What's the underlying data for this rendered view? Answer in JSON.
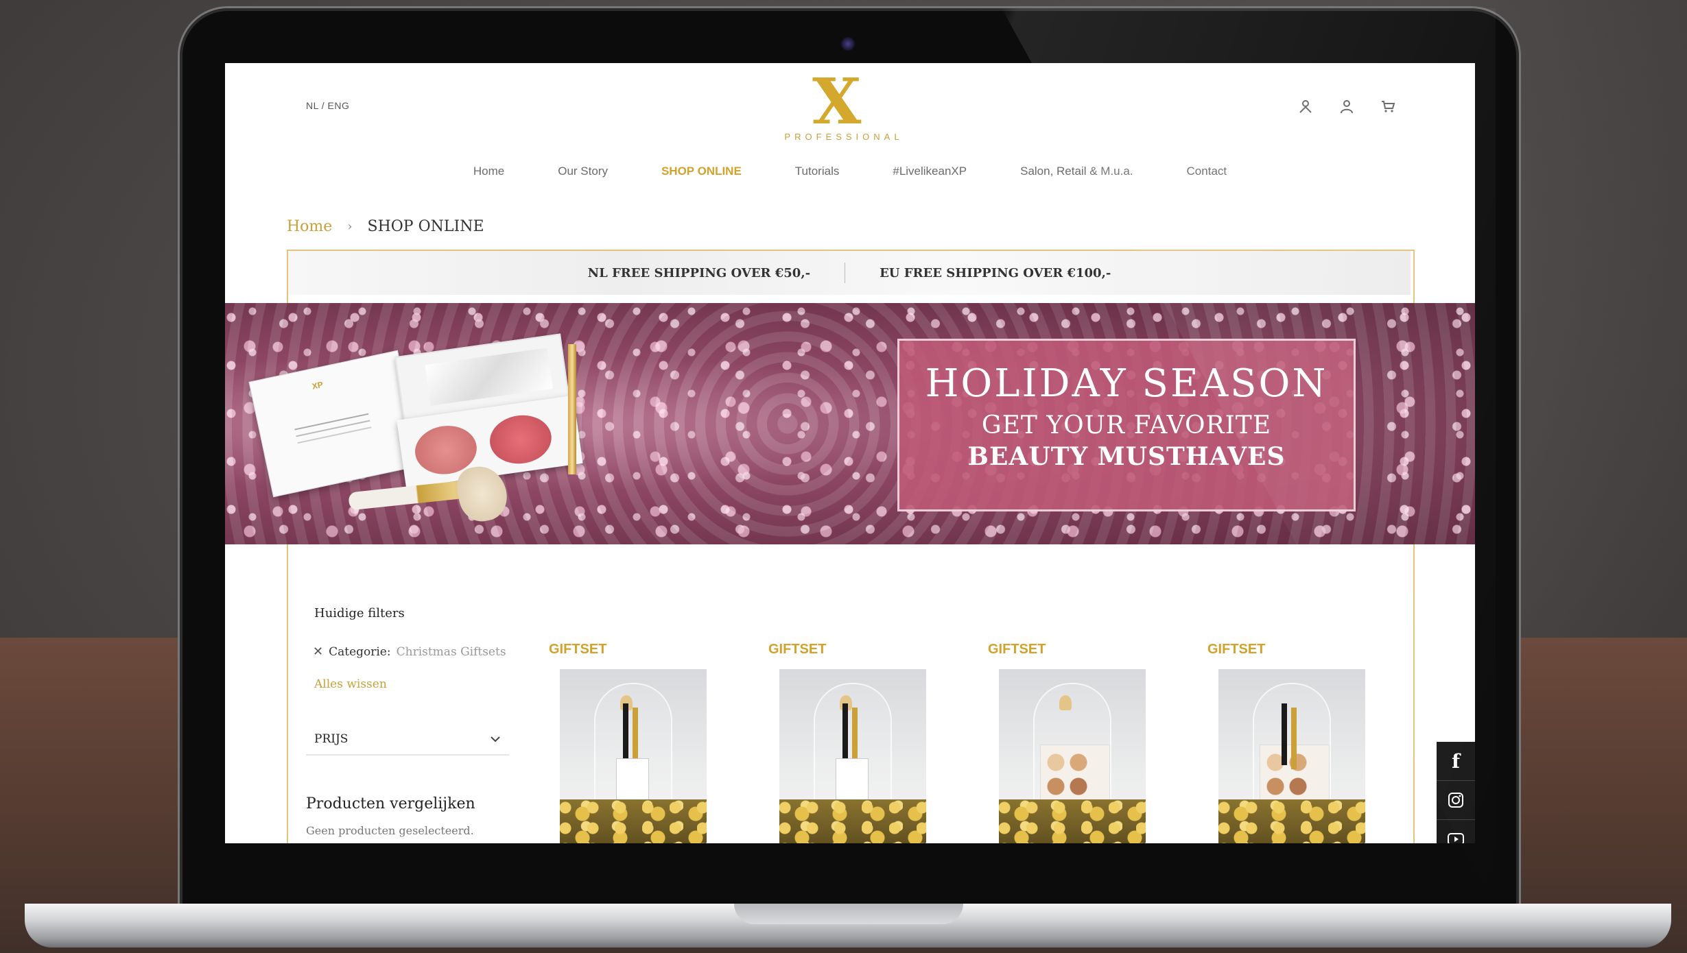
{
  "header": {
    "lang_switch": "NL / ENG",
    "logo_mark": "X",
    "logo_text": "PROFESSIONAL"
  },
  "icons": {
    "account": "user-icon",
    "login": "person-icon",
    "cart": "cart-icon"
  },
  "nav": {
    "items": [
      {
        "label": "Home",
        "active": false
      },
      {
        "label": "Our Story",
        "active": false
      },
      {
        "label": "SHOP ONLINE",
        "active": true
      },
      {
        "label": "Tutorials",
        "active": false
      },
      {
        "label": "#LivelikeanXP",
        "active": false
      },
      {
        "label": "Salon, Retail & M.u.a.",
        "active": false
      },
      {
        "label": "Contact",
        "active": false
      }
    ]
  },
  "breadcrumb": {
    "home": "Home",
    "current": "SHOP ONLINE"
  },
  "shipping": {
    "nl": "NL FREE SHIPPING OVER €50,-",
    "eu": "EU FREE SHIPPING OVER €100,-"
  },
  "banner": {
    "title": "HOLIDAY SEASON",
    "line1": "GET YOUR FAVORITE",
    "line2": "BEAUTY MUSTHAVES"
  },
  "filters": {
    "title": "Huidige filters",
    "category_label": "Categorie:",
    "category_value": "Christmas Giftsets",
    "clear": "Alles wissen",
    "price": "PRIJS"
  },
  "compare": {
    "title": "Producten vergelijken",
    "empty": "Geen producten geselecteerd."
  },
  "products": [
    {
      "category": "GIFTSET"
    },
    {
      "category": "GIFTSET"
    },
    {
      "category": "GIFTSET"
    },
    {
      "category": "GIFTSET"
    }
  ],
  "social": {
    "facebook": "f",
    "instagram": "instagram-icon",
    "youtube": "youtube-icon"
  },
  "colors": {
    "accent": "#d4a22c",
    "border": "#e2c47c",
    "promo_bg": "#be5a78"
  }
}
